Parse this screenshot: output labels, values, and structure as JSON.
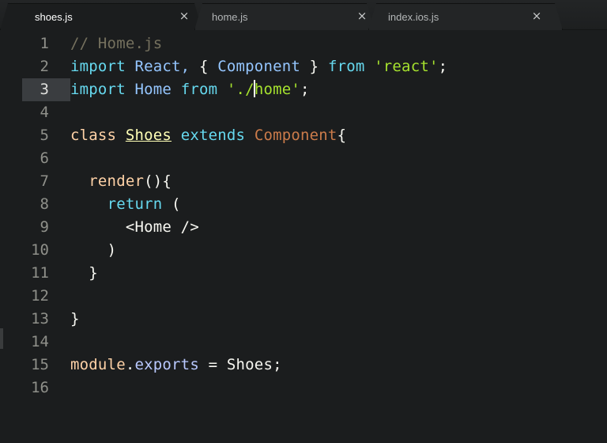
{
  "tabs": [
    {
      "label": "shoes.js",
      "active": true,
      "close": "×"
    },
    {
      "label": "home.js",
      "active": false,
      "close": "×"
    },
    {
      "label": "index.ios.js",
      "active": false,
      "close": "×"
    }
  ],
  "gutter": {
    "line_numbers": [
      "1",
      "2",
      "3",
      "4",
      "5",
      "6",
      "7",
      "8",
      "9",
      "10",
      "11",
      "12",
      "13",
      "14",
      "15",
      "16"
    ],
    "current_line": "3"
  },
  "code": {
    "l1": {
      "comment": "// Home.js"
    },
    "l2": {
      "kw_import": "import",
      "react": "React,",
      "brace_open": "{",
      "component": "Component",
      "brace_close": "}",
      "kw_from": "from",
      "str": "'react'",
      "semi": ";"
    },
    "l3": {
      "kw_import": "import",
      "home": "Home",
      "kw_from": "from",
      "str_a": "'./",
      "str_b": "home'",
      "semi": ";"
    },
    "l5": {
      "kw_class": "class",
      "cls": "Shoes",
      "kw_extends": "extends",
      "cmp": "Component",
      "brace": "{"
    },
    "l7": {
      "fn": "render",
      "rest": "(){"
    },
    "l8": {
      "kw_return": "return",
      "paren": "("
    },
    "l9": {
      "jsx": "<Home />"
    },
    "l10": {
      "paren": ")"
    },
    "l11": {
      "brace": "}"
    },
    "l13": {
      "brace": "}"
    },
    "l15": {
      "module": "module",
      "dot": ".",
      "exports": "exports",
      "rest": " = Shoes;"
    }
  },
  "colors": {
    "background": "#1b1d1e",
    "keyword": "#66d9ef",
    "string": "#a6e22e",
    "comment": "#75715e",
    "class_name": "#ffffb6",
    "superclass": "#cb7b4a"
  }
}
